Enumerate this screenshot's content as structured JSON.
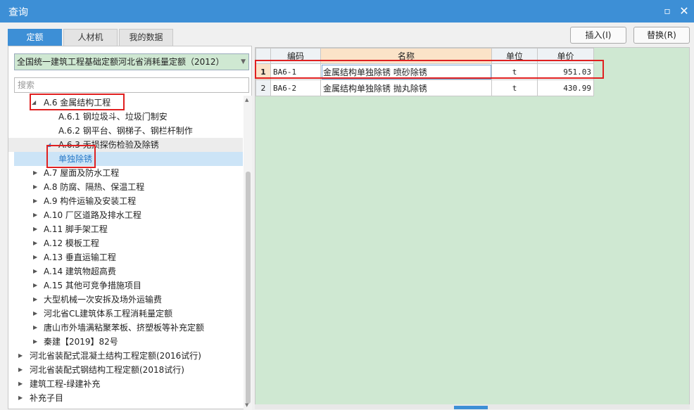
{
  "window": {
    "title": "查询",
    "maximize_icon": "maximize-icon",
    "close_icon": "close-icon"
  },
  "tabs": [
    {
      "label": "定额",
      "active": true
    },
    {
      "label": "人材机"
    },
    {
      "label": "我的数据"
    }
  ],
  "actions": {
    "insert_label": "插入(I)",
    "replace_label": "替换(R)"
  },
  "left": {
    "library_select": "全国统一建筑工程基础定额河北省消耗量定额（2012）",
    "search_placeholder": "搜索",
    "tree": [
      {
        "label": "A.6 金属结构工程",
        "expanded": true
      },
      {
        "label": "A.6.1 钢垃圾斗、垃圾门制安"
      },
      {
        "label": "A.6.2 钢平台、钢梯子、钢栏杆制作"
      },
      {
        "label": "A.6.3 无损探伤检验及除锈",
        "expanded": true
      },
      {
        "label": "单独除锈",
        "selected": true
      },
      {
        "label": "A.7 屋面及防水工程"
      },
      {
        "label": "A.8 防腐、隔热、保温工程"
      },
      {
        "label": "A.9 构件运输及安装工程"
      },
      {
        "label": "A.10 厂区道路及排水工程"
      },
      {
        "label": "A.11 脚手架工程"
      },
      {
        "label": "A.12 模板工程"
      },
      {
        "label": "A.13 垂直运输工程"
      },
      {
        "label": "A.14 建筑物超高费"
      },
      {
        "label": "A.15 其他可竞争措施项目"
      },
      {
        "label": "大型机械一次安拆及场外运输费"
      },
      {
        "label": "河北省CL建筑体系工程消耗量定额"
      },
      {
        "label": "唐山市外墙满粘聚苯板、挤塑板等补充定额"
      },
      {
        "label": "秦建【2019】82号"
      },
      {
        "label": "河北省装配式混凝土结构工程定额(2016试行)"
      },
      {
        "label": "河北省装配式钢结构工程定额(2018试行)"
      },
      {
        "label": "建筑工程-绿建补充"
      },
      {
        "label": "补充子目"
      }
    ]
  },
  "grid": {
    "headers": {
      "code": "编码",
      "name": "名称",
      "unit": "单位",
      "price": "单价"
    },
    "rows": [
      {
        "no": "1",
        "code": "BA6-1",
        "name": "金属结构单独除锈 喷砂除锈",
        "unit": "t",
        "price": "951.03"
      },
      {
        "no": "2",
        "code": "BA6-2",
        "name": "金属结构单独除锈 抛丸除锈",
        "unit": "t",
        "price": "430.99"
      }
    ]
  },
  "colors": {
    "accent": "#3d8fd6",
    "highlight_box": "#e02020",
    "grid_bg": "#cfe8d2"
  }
}
